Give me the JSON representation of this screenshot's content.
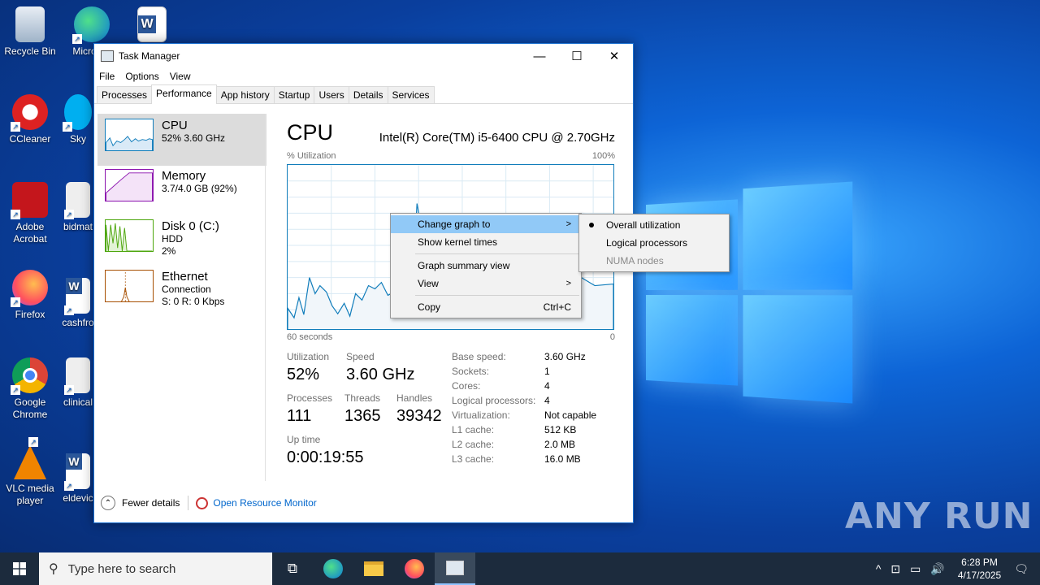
{
  "desktop": {
    "icons": [
      {
        "label": "Recycle Bin",
        "icon": "recycle-bin-icon"
      },
      {
        "label": "Micro Ed",
        "icon": "edge-icon"
      },
      {
        "label": "CCleaner",
        "icon": "ccleaner-icon"
      },
      {
        "label": "Sky",
        "icon": "skype-icon"
      },
      {
        "label": "Adobe Acrobat",
        "icon": "acrobat-icon"
      },
      {
        "label": "bidmat",
        "icon": "image-file-icon"
      },
      {
        "label": "Firefox",
        "icon": "firefox-icon"
      },
      {
        "label": "cashfro",
        "icon": "word-doc-icon"
      },
      {
        "label": "Google Chrome",
        "icon": "chrome-icon"
      },
      {
        "label": "clinical",
        "icon": "image-file-icon"
      },
      {
        "label": "VLC media player",
        "icon": "vlc-icon"
      },
      {
        "label": "eldevic",
        "icon": "word-doc-icon"
      }
    ],
    "watermark": "ANY RUN"
  },
  "window": {
    "title": "Task Manager",
    "controls": {
      "minimize": "—",
      "maximize": "☐",
      "close": "✕"
    },
    "menu": [
      "File",
      "Options",
      "View"
    ],
    "tabs": [
      "Processes",
      "Performance",
      "App history",
      "Startup",
      "Users",
      "Details",
      "Services"
    ],
    "active_tab": "Performance"
  },
  "sidebar": {
    "items": [
      {
        "name": "CPU",
        "sub1": "52%  3.60 GHz",
        "sub2": "",
        "color": "#117dbb"
      },
      {
        "name": "Memory",
        "sub1": "3.7/4.0 GB (92%)",
        "sub2": "",
        "color": "#8b12ae"
      },
      {
        "name": "Disk 0 (C:)",
        "sub1": "HDD",
        "sub2": "2%",
        "color": "#4da60c"
      },
      {
        "name": "Ethernet",
        "sub1": "Connection",
        "sub2": "S: 0  R: 0 Kbps",
        "color": "#a74f01"
      }
    ]
  },
  "cpu": {
    "title": "CPU",
    "model": "Intel(R) Core(TM) i5-6400 CPU @ 2.70GHz",
    "graph_label": "% Utilization",
    "graph_max": "100%",
    "axis_left": "60 seconds",
    "axis_right": "0",
    "stats": {
      "utilization_label": "Utilization",
      "utilization": "52%",
      "speed_label": "Speed",
      "speed": "3.60 GHz",
      "processes_label": "Processes",
      "processes": "111",
      "threads_label": "Threads",
      "threads": "1365",
      "handles_label": "Handles",
      "handles": "39342",
      "uptime_label": "Up time",
      "uptime": "0:00:19:55"
    },
    "specs": [
      {
        "k": "Base speed:",
        "v": "3.60 GHz"
      },
      {
        "k": "Sockets:",
        "v": "1"
      },
      {
        "k": "Cores:",
        "v": "4"
      },
      {
        "k": "Logical processors:",
        "v": "4"
      },
      {
        "k": "Virtualization:",
        "v": "Not capable"
      },
      {
        "k": "L1 cache:",
        "v": "512 KB"
      },
      {
        "k": "L2 cache:",
        "v": "2.0 MB"
      },
      {
        "k": "L3 cache:",
        "v": "16.0 MB"
      }
    ]
  },
  "footer": {
    "fewer_details": "Fewer details",
    "resource_monitor": "Open Resource Monitor"
  },
  "context_menu": {
    "items": [
      "Change graph to",
      "Show kernel times",
      "Graph summary view",
      "View",
      "Copy"
    ],
    "copy_shortcut": "Ctrl+C"
  },
  "submenu": {
    "items": [
      "Overall utilization",
      "Logical processors",
      "NUMA nodes"
    ]
  },
  "taskbar": {
    "search_placeholder": "Type here to search",
    "time": "6:28 PM",
    "date": "4/17/2025"
  }
}
